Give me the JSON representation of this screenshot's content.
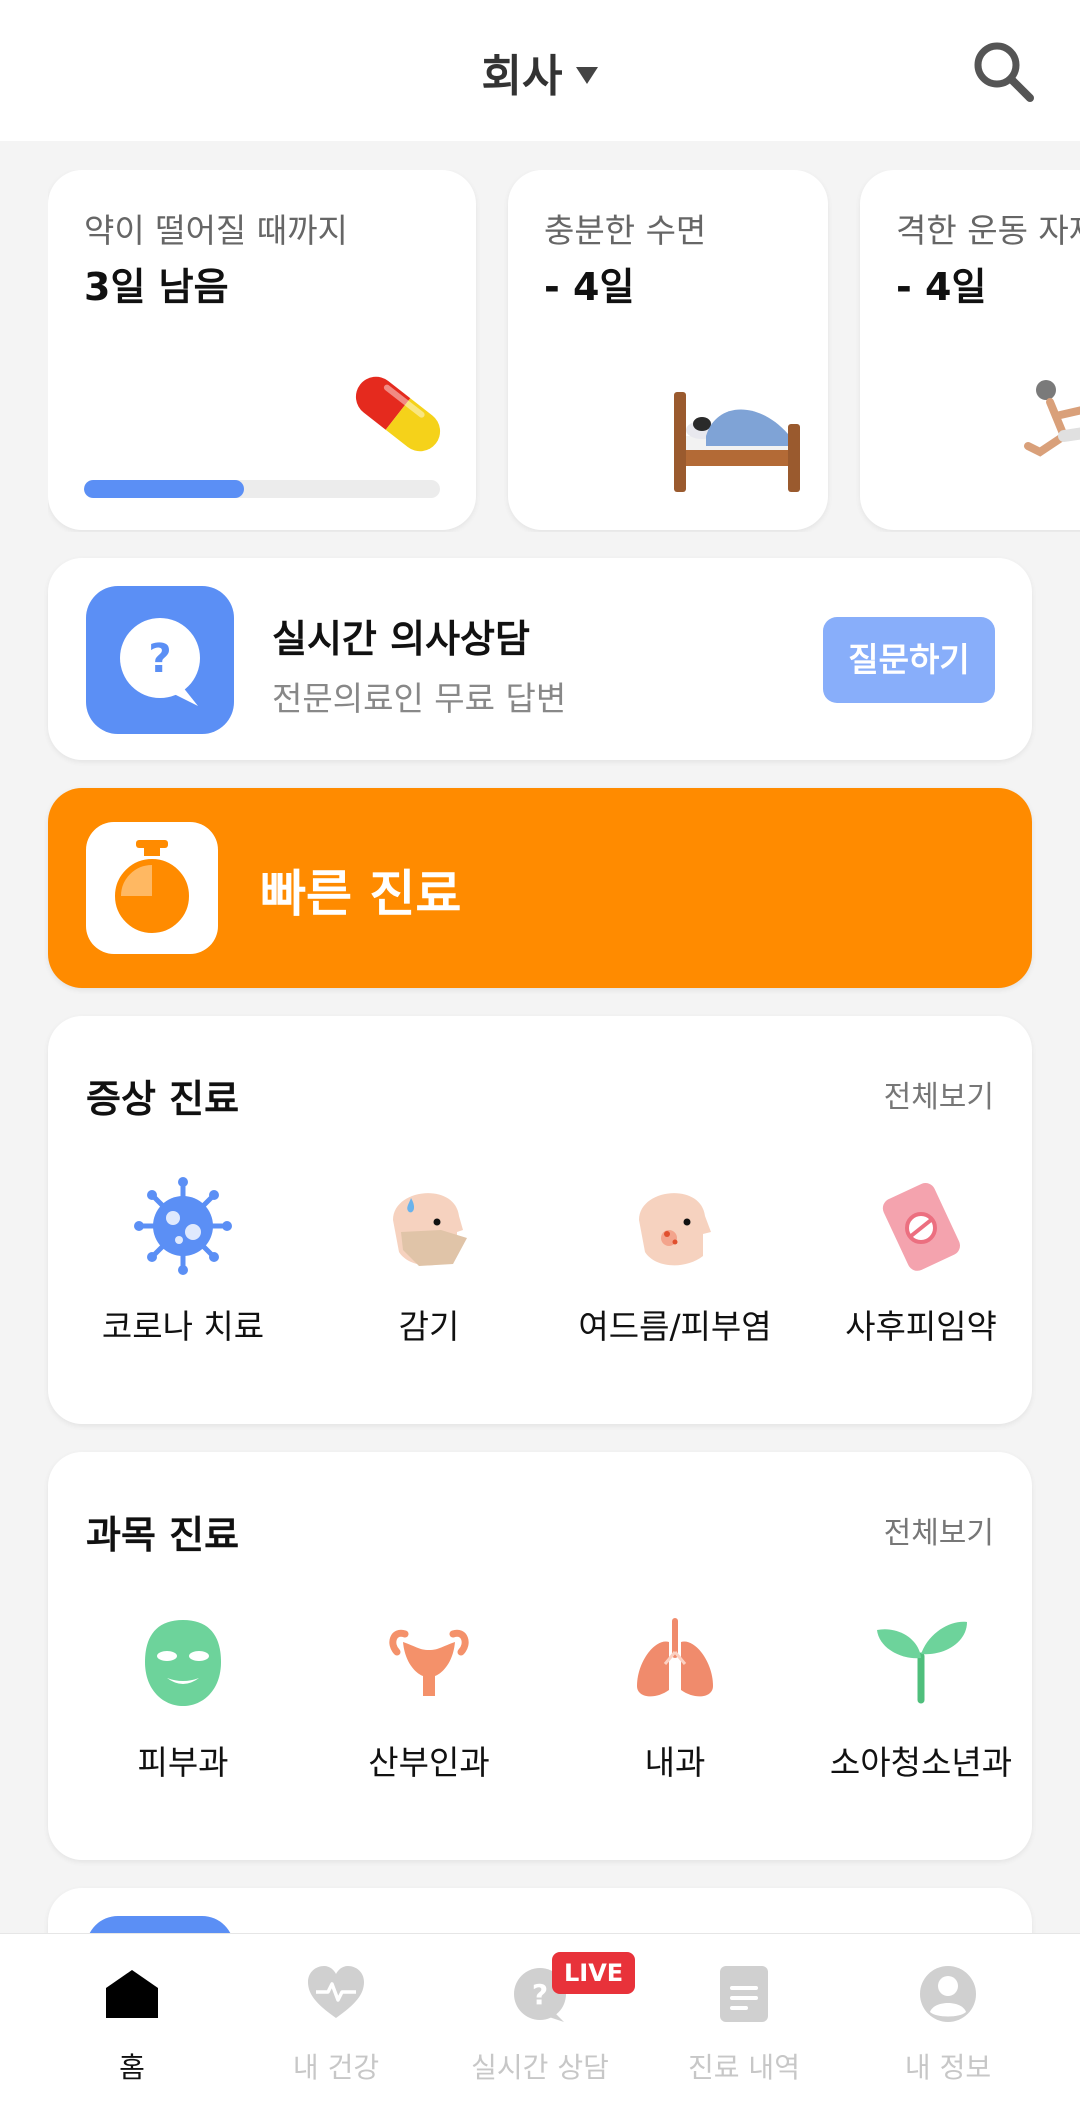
{
  "header": {
    "location": "회사",
    "search_icon": "search-icon"
  },
  "status_cards": [
    {
      "title": "약이 떨어질 때까지",
      "value": "3일 남음",
      "progress": 0.45,
      "icon": "pill-icon"
    },
    {
      "title": "충분한 수면",
      "value": "- 4일",
      "icon": "bed-icon"
    },
    {
      "title": "격한 운동 자제",
      "value": "- 4일",
      "icon": "exercise-icon"
    }
  ],
  "consult": {
    "title": "실시간 의사상담",
    "subtitle": "전문의료인 무료 답변",
    "button": "질문하기"
  },
  "quick": {
    "label": "빠른 진료"
  },
  "symptom": {
    "title": "증상 진료",
    "more": "전체보기",
    "items": [
      {
        "label": "코로나 치료",
        "icon": "virus-icon"
      },
      {
        "label": "감기",
        "icon": "mask-face-icon"
      },
      {
        "label": "여드름/피부염",
        "icon": "acne-face-icon"
      },
      {
        "label": "사후피임약",
        "icon": "pill-pack-icon"
      }
    ]
  },
  "department": {
    "title": "과목 진료",
    "more": "전체보기",
    "items": [
      {
        "label": "피부과",
        "icon": "face-mask-icon"
      },
      {
        "label": "산부인과",
        "icon": "uterus-icon"
      },
      {
        "label": "내과",
        "icon": "lungs-icon"
      },
      {
        "label": "소아청소년과",
        "icon": "sprout-icon"
      }
    ]
  },
  "tabs": [
    {
      "label": "홈",
      "active": true
    },
    {
      "label": "내 건강"
    },
    {
      "label": "실시간 상담",
      "badge": "LIVE"
    },
    {
      "label": "진료 내역"
    },
    {
      "label": "내 정보"
    }
  ],
  "colors": {
    "primary_blue": "#5b8ff5",
    "orange": "#ff8b00",
    "live_red": "#e8323a"
  }
}
